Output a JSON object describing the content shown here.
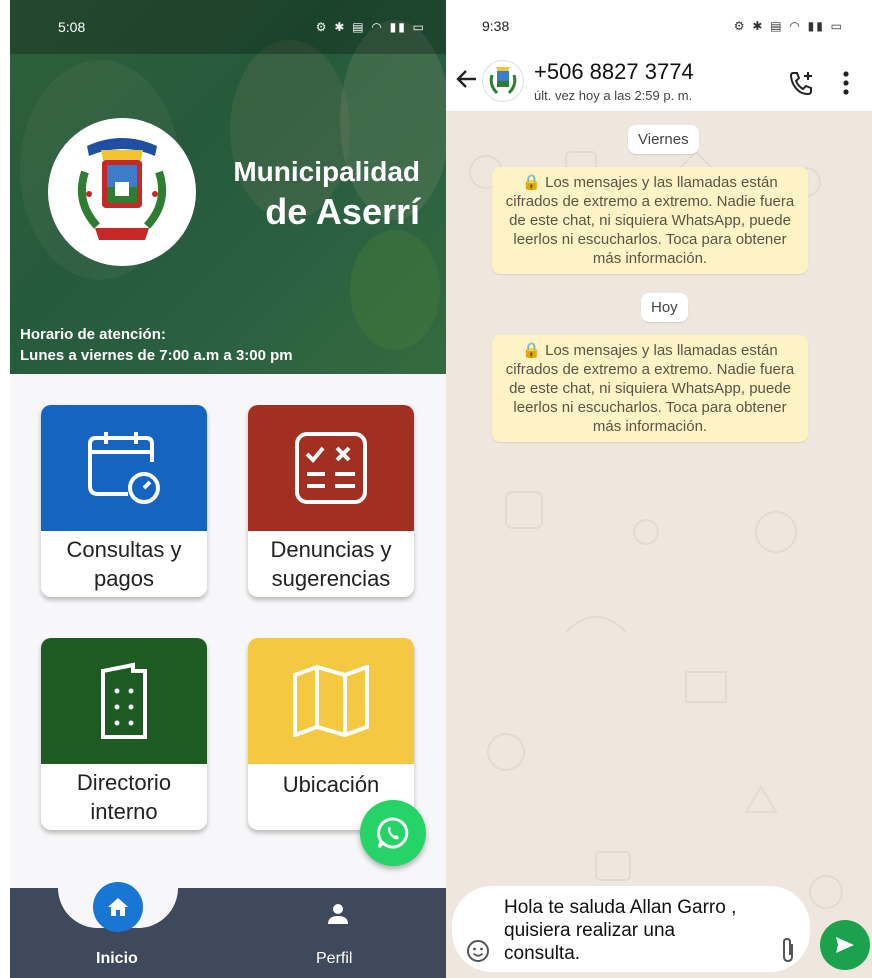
{
  "left_app": {
    "status_bar": {
      "time": "5:08"
    },
    "header": {
      "title_line1": "Municipalidad",
      "title_line2": "de Aserrí",
      "hours_line1": "Horario de atención:",
      "hours_line2": "Lunes a viernes de 7:00 a.m a 3:00 pm"
    },
    "tiles": [
      {
        "label_line1": "Consultas y",
        "label_line2": "pagos",
        "color": "#1565c0",
        "icon": "calendar-clock-icon"
      },
      {
        "label_line1": "Denuncias y",
        "label_line2": "sugerencias",
        "color": "#a23022",
        "icon": "checklist-icon"
      },
      {
        "label_line1": "Directorio",
        "label_line2": "interno",
        "color": "#1d5b22",
        "icon": "building-icon"
      },
      {
        "label_line1": "Ubicación",
        "label_line2": "",
        "color": "#f5c842",
        "icon": "map-icon"
      }
    ],
    "fab": {
      "icon": "whatsapp-icon",
      "color": "#25d366"
    },
    "bottom_nav": {
      "items": [
        {
          "label": "Inicio",
          "icon": "home-icon",
          "active": true
        },
        {
          "label": "Perfil",
          "icon": "person-icon",
          "active": false
        }
      ],
      "background": "#3e4a5b",
      "active_color": "#1976d2"
    }
  },
  "right_app": {
    "status_bar": {
      "time": "9:38"
    },
    "chat_header": {
      "contact": "+506 8827 3774",
      "last_seen": "últ. vez hoy a las 2:59 p. m."
    },
    "messages": [
      {
        "type": "date",
        "text": "Viernes"
      },
      {
        "type": "system",
        "text": "🔒 Los mensajes y las llamadas están cifrados de extremo a extremo. Nadie fuera de este chat, ni siquiera WhatsApp, puede leerlos ni escucharlos. Toca para obtener más información."
      },
      {
        "type": "date",
        "text": "Hoy"
      },
      {
        "type": "system",
        "text": "🔒 Los mensajes y las llamadas están cifrados de extremo a extremo. Nadie fuera de este chat, ni siquiera WhatsApp, puede leerlos ni escucharlos. Toca para obtener más información."
      }
    ],
    "composer": {
      "value": "Hola te saluda Allan Garro , quisiera realizar una consulta."
    },
    "send_color": "#1ca14c"
  }
}
